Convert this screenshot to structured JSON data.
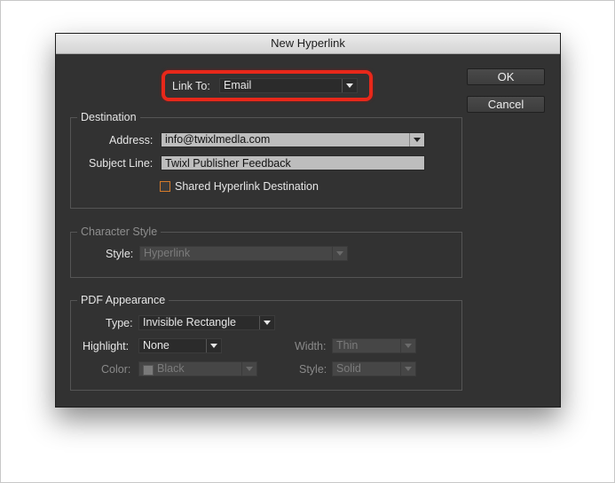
{
  "dialog": {
    "title": "New Hyperlink",
    "ok_label": "OK",
    "cancel_label": "Cancel"
  },
  "link_to": {
    "label": "Link To:",
    "value": "Email"
  },
  "destination": {
    "title": "Destination",
    "address_label": "Address:",
    "address_value": "info@twixlmedla.com",
    "subject_label": "Subject Line:",
    "subject_value": "Twixl Publisher Feedback",
    "shared_label": "Shared Hyperlink Destination",
    "shared_checked": false
  },
  "character_style": {
    "title": "Character Style",
    "style_label": "Style:",
    "style_value": "Hyperlink"
  },
  "pdf_appearance": {
    "title": "PDF Appearance",
    "type_label": "Type:",
    "type_value": "Invisible Rectangle",
    "highlight_label": "Highlight:",
    "highlight_value": "None",
    "color_label": "Color:",
    "color_value": "Black",
    "width_label": "Width:",
    "width_value": "Thin",
    "style_label": "Style:",
    "style_value": "Solid"
  },
  "colors": {
    "dialog_bg": "#323232",
    "highlight_ring": "#e8281a",
    "checkbox_border": "#d47a2a"
  }
}
